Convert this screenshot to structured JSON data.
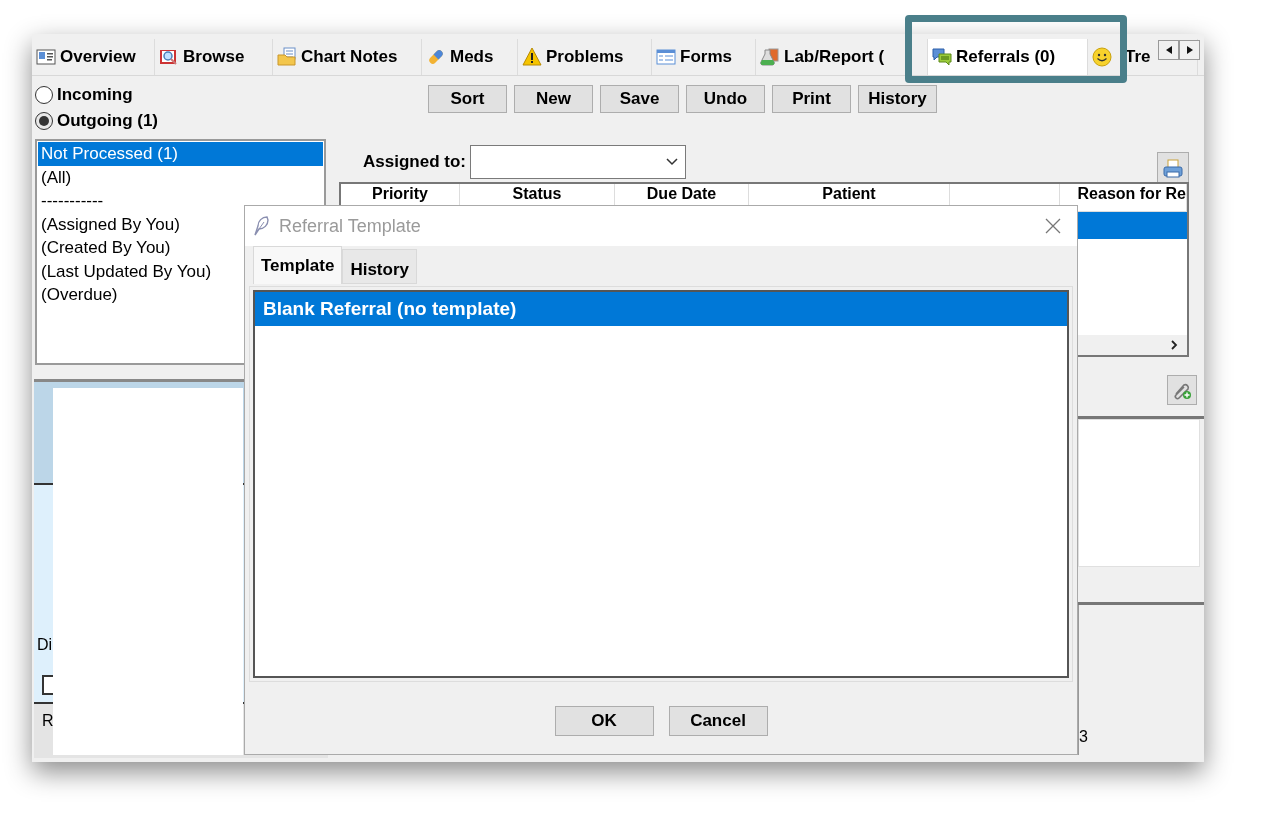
{
  "tabs": [
    {
      "label": "Overview",
      "kind": "overview",
      "selected": false
    },
    {
      "label": "Browse",
      "kind": "browse",
      "selected": false
    },
    {
      "label": "Chart Notes",
      "kind": "notes",
      "selected": false
    },
    {
      "label": "Meds",
      "kind": "meds",
      "selected": false
    },
    {
      "label": "Problems",
      "kind": "problems",
      "selected": false
    },
    {
      "label": "Forms",
      "kind": "forms",
      "selected": false
    },
    {
      "label": "Lab/Report (",
      "kind": "lab",
      "selected": false
    },
    {
      "label": "Referrals (0)",
      "kind": "referrals",
      "selected": true
    },
    {
      "label": "Tre",
      "kind": "treatment",
      "selected": false
    }
  ],
  "direction_options": [
    {
      "label": "Incoming",
      "selected": false
    },
    {
      "label": "Outgoing (1)",
      "selected": true
    }
  ],
  "filters": [
    {
      "label": "Not Processed (1)",
      "selected": true
    },
    {
      "label": "(All)",
      "selected": false
    },
    {
      "label": "-----------",
      "selected": false
    },
    {
      "label": "(Assigned By You)",
      "selected": false
    },
    {
      "label": "(Created By You)",
      "selected": false
    },
    {
      "label": "(Last Updated By You)",
      "selected": false
    },
    {
      "label": "(Overdue)",
      "selected": false
    }
  ],
  "toolbar_buttons": [
    "Sort",
    "New",
    "Save",
    "Undo",
    "Print",
    "History"
  ],
  "assigned_to_label": "Assigned to:",
  "table": {
    "columns": [
      {
        "label": "Priority",
        "kind": "text"
      },
      {
        "label": "Status",
        "kind": "text"
      },
      {
        "label": "Due Date",
        "kind": "text"
      },
      {
        "label": "Patient",
        "kind": "text"
      },
      {
        "kind": "blank"
      },
      {
        "label": "Reason for Re",
        "kind": "text"
      }
    ],
    "rows": [
      {
        "selected": true
      }
    ]
  },
  "lower_left": {
    "label": "Di",
    "row_label": "R",
    "checkbox_checked": false
  },
  "right_fragment": "3",
  "dialog": {
    "title": "Referral Template",
    "tabs": [
      {
        "label": "Template",
        "selected": true
      },
      {
        "label": "History",
        "selected": false
      }
    ],
    "items": [
      {
        "label": "Blank Referral (no template)",
        "selected": true
      }
    ],
    "buttons": [
      "OK",
      "Cancel"
    ]
  }
}
